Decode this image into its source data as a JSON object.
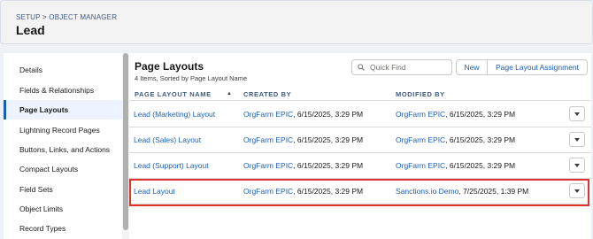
{
  "header": {
    "breadcrumb_setup": "SETUP",
    "breadcrumb_sep": ">",
    "breadcrumb_object_manager": "OBJECT MANAGER",
    "title": "Lead"
  },
  "sidebar": {
    "items": [
      {
        "label": "Details"
      },
      {
        "label": "Fields & Relationships"
      },
      {
        "label": "Page Layouts",
        "active": true
      },
      {
        "label": "Lightning Record Pages"
      },
      {
        "label": "Buttons, Links, and Actions"
      },
      {
        "label": "Compact Layouts"
      },
      {
        "label": "Field Sets"
      },
      {
        "label": "Object Limits"
      },
      {
        "label": "Record Types"
      }
    ]
  },
  "main": {
    "title": "Page Layouts",
    "subtitle": "4 Items, Sorted by Page Layout Name",
    "search": {
      "placeholder": "Quick Find"
    },
    "buttons": {
      "new": "New",
      "assignment": "Page Layout Assignment"
    },
    "columns": [
      "PAGE LAYOUT NAME",
      "CREATED BY",
      "MODIFIED BY"
    ],
    "rows": [
      {
        "name": "Lead (Marketing) Layout",
        "created_by": "OrgFarm EPIC",
        "created_at": ", 6/15/2025, 3:29 PM",
        "modified_by": "OrgFarm EPIC",
        "modified_at": ", 6/15/2025, 3:29 PM"
      },
      {
        "name": "Lead (Sales) Layout",
        "created_by": "OrgFarm EPIC",
        "created_at": ", 6/15/2025, 3:29 PM",
        "modified_by": "OrgFarm EPIC",
        "modified_at": ", 6/15/2025, 3:29 PM"
      },
      {
        "name": "Lead (Support) Layout",
        "created_by": "OrgFarm EPIC",
        "created_at": ", 6/15/2025, 3:29 PM",
        "modified_by": "OrgFarm EPIC",
        "modified_at": ", 6/15/2025, 3:29 PM"
      },
      {
        "name": "Lead Layout",
        "created_by": "OrgFarm EPIC",
        "created_at": ", 6/15/2025, 3:29 PM",
        "modified_by": "Sanctions.io Demo",
        "modified_at": ", 7/25/2025, 1:39 PM"
      }
    ]
  },
  "colors": {
    "link": "#1b5fb5",
    "highlight": "#e0322c"
  },
  "icons": {
    "search": "search-icon",
    "sort": "sort-up-icon",
    "row_menu": "chevron-down-icon"
  }
}
